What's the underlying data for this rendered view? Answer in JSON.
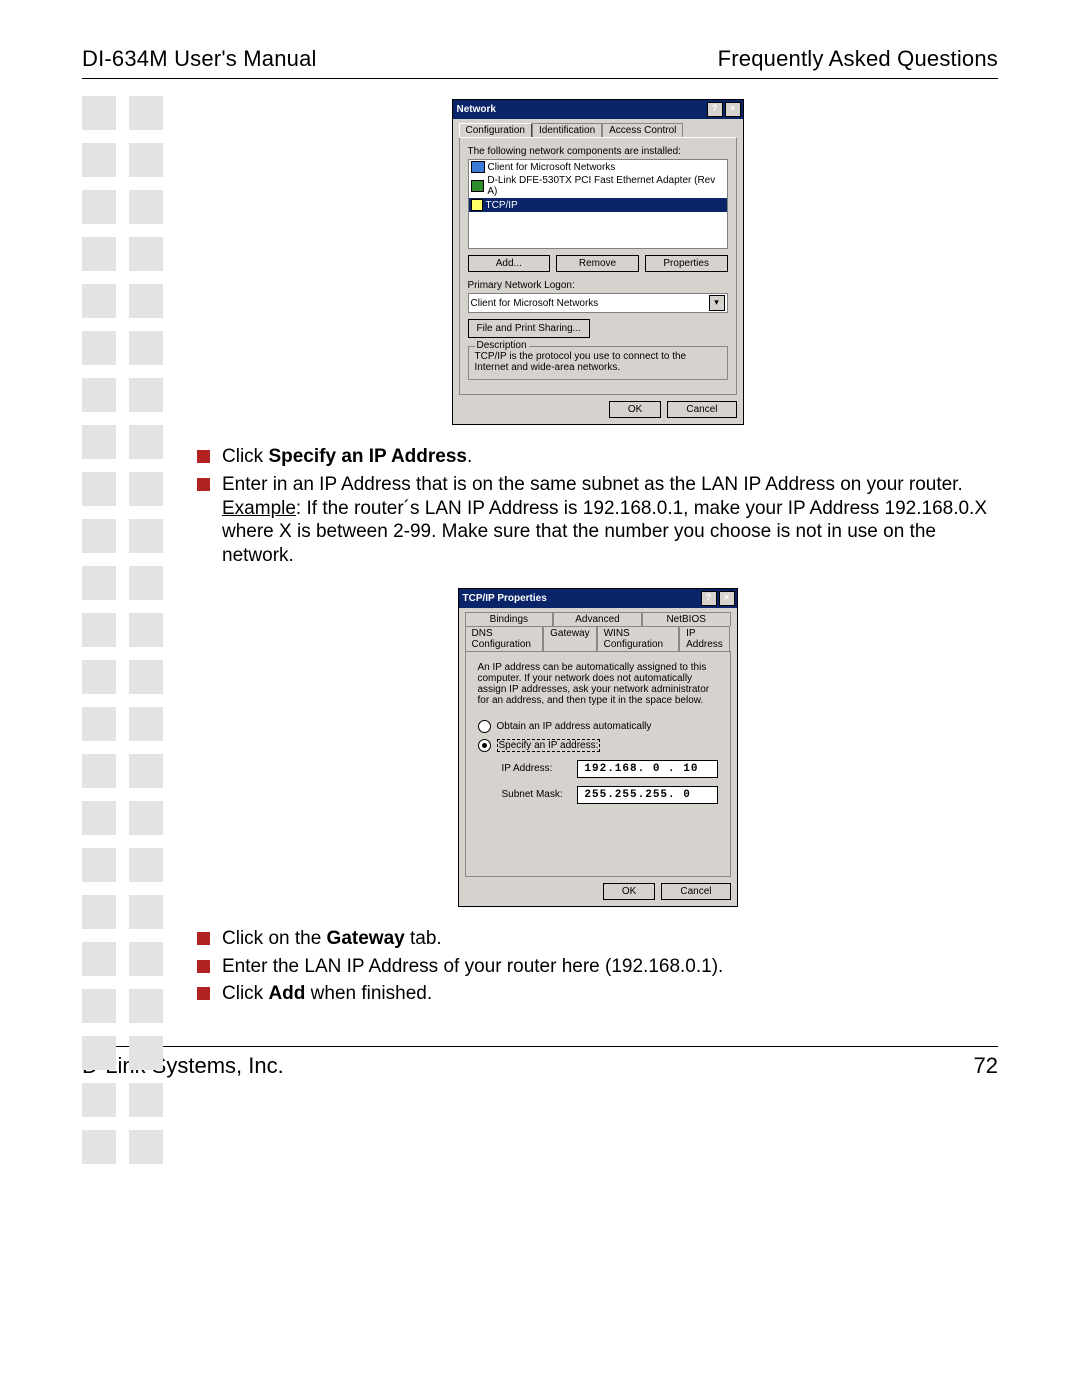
{
  "header": {
    "left": "DI-634M User's Manual",
    "right": "Frequently Asked Questions"
  },
  "footer": {
    "left": "D-Link Systems, Inc.",
    "right": "72"
  },
  "dialog1": {
    "title": "Network",
    "help": "?",
    "close": "×",
    "tabs": {
      "t1": "Configuration",
      "t2": "Identification",
      "t3": "Access Control"
    },
    "installed_label": "The following network components are installed:",
    "items": {
      "i1": "Client for Microsoft Networks",
      "i2": "D-Link DFE-530TX PCI Fast Ethernet Adapter (Rev A)",
      "i3": "TCP/IP"
    },
    "buttons": {
      "add": "Add...",
      "remove": "Remove",
      "properties": "Properties"
    },
    "primary_label": "Primary Network Logon:",
    "primary_value": "Client for Microsoft Networks",
    "file_print": "File and Print Sharing...",
    "desc_title": "Description",
    "desc_text": "TCP/IP is the protocol you use to connect to the Internet and wide-area networks.",
    "ok": "OK",
    "cancel": "Cancel"
  },
  "bullets1": {
    "b1a": "Click ",
    "b1b": "Specify an IP Address",
    "b1c": ".",
    "b2a": "Enter in an IP Address that is on the same subnet as the LAN IP Address on your router. ",
    "b2b": "Example",
    "b2c": ": If the router´s LAN IP Address is 192.168.0.1, make your IP Address 192.168.0.X where X is between 2-99. Make sure that the number you choose is not in use on the network."
  },
  "dialog2": {
    "title": "TCP/IP Properties",
    "help": "?",
    "close": "×",
    "tabs": {
      "t1": "Bindings",
      "t2": "Advanced",
      "t3": "NetBIOS",
      "t4": "DNS Configuration",
      "t5": "Gateway",
      "t6": "WINS Configuration",
      "t7": "IP Address"
    },
    "intro": "An IP address can be automatically assigned to this computer. If your network does not automatically assign IP addresses, ask your network administrator for an address, and then type it in the space below.",
    "r1": "Obtain an IP address automatically",
    "r2": "Specify an IP address:",
    "ip_label": "IP Address:",
    "ip_value": "192.168. 0 . 10",
    "mask_label": "Subnet Mask:",
    "mask_value": "255.255.255. 0",
    "ok": "OK",
    "cancel": "Cancel"
  },
  "bullets2": {
    "b1a": "Click on the ",
    "b1b": "Gateway",
    "b1c": " tab.",
    "b2": "Enter the LAN IP Address of your router here (192.168.0.1).",
    "b3a": "Click ",
    "b3b": "Add",
    "b3c": " when finished."
  }
}
